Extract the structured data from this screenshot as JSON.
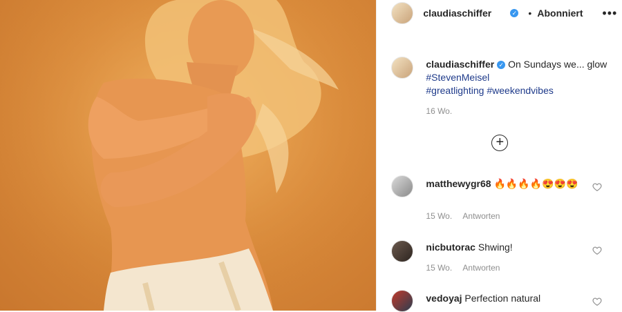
{
  "header": {
    "username": "claudiaschiffer",
    "separator": "•",
    "follow_status": "Abonniert",
    "more": "•••"
  },
  "caption": {
    "username": "claudiaschiffer",
    "text": "On Sundays we... glow",
    "hashtags": [
      "#StevenMeisel",
      "#greatlighting",
      "#weekendvibes"
    ],
    "time": "16 Wo."
  },
  "load_more": "+",
  "comments": [
    {
      "username": "matthewygr68",
      "text": "🔥🔥🔥🔥😍😍😍",
      "time": "15 Wo.",
      "reply": "Antworten"
    },
    {
      "username": "nicbutorac",
      "text": "Shwing!",
      "time": "15 Wo.",
      "reply": "Antworten"
    },
    {
      "username": "vedoyaj",
      "text": "Perfection natural",
      "time": "",
      "reply": ""
    }
  ],
  "icons": {
    "verified": "verified-badge-icon",
    "more": "more-options-icon",
    "load_more": "plus-circle-icon",
    "like": "heart-icon"
  },
  "colors": {
    "accent_blue": "#3897f0",
    "hashtag": "#1e3a8a",
    "muted": "#8e8e8e",
    "photo_bg": "#d98a3a"
  }
}
